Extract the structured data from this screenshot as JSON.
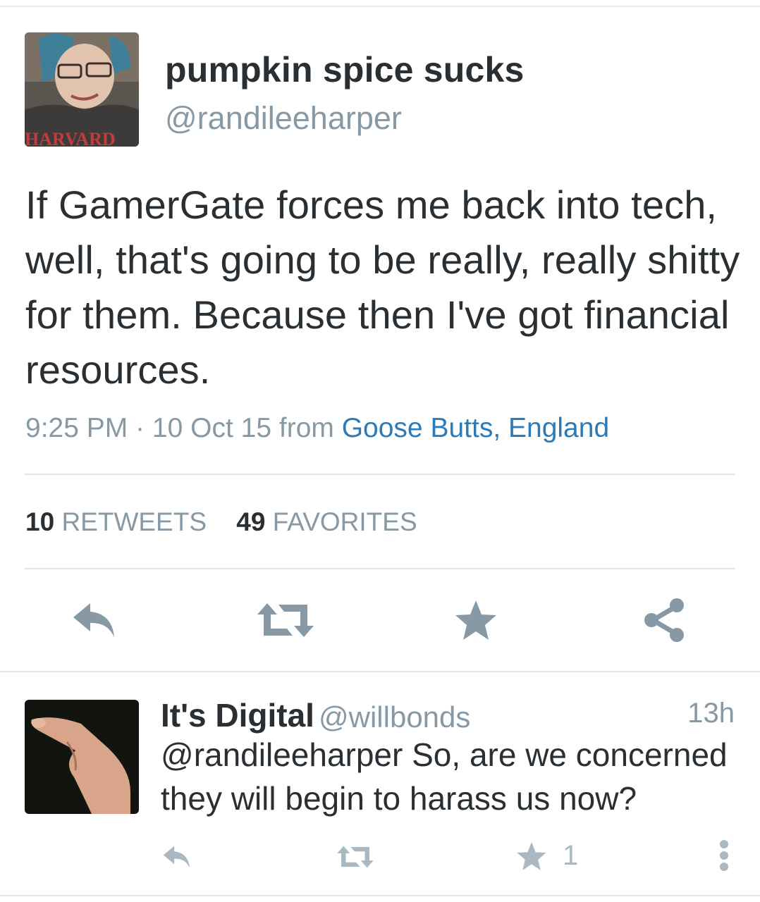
{
  "main_tweet": {
    "display_name": "pumpkin spice sucks",
    "handle": "@randileeharper",
    "avatar_text": "HARVARD",
    "text": "If GamerGate forces me back into tech, well, that's going to be really, really shitty for them. Because then I've got financial resources.",
    "time": "9:25 PM",
    "separator": " · ",
    "date": "10 Oct 15",
    "from_label": "from",
    "location": "Goose Butts, England",
    "retweets_count": "10",
    "retweets_label": "RETWEETS",
    "favorites_count": "49",
    "favorites_label": "FAVORITES",
    "actions": [
      "reply-icon",
      "retweet-icon",
      "favorite-icon",
      "share-icon"
    ]
  },
  "reply_tweet": {
    "display_name": "It's Digital",
    "handle": "@willbonds",
    "time": "13h",
    "text": "@randileeharper So, are we concerned they will begin to harass us now?",
    "favorite_count": "1",
    "actions": [
      "reply-icon",
      "retweet-icon",
      "favorite-icon",
      "more-icon"
    ]
  },
  "colors": {
    "text": "#292f33",
    "muted": "#8899a6",
    "link": "#2b7bb9",
    "icon": "#8899a6",
    "icon_light": "#aab8c2",
    "divider": "#e1e8ed"
  }
}
